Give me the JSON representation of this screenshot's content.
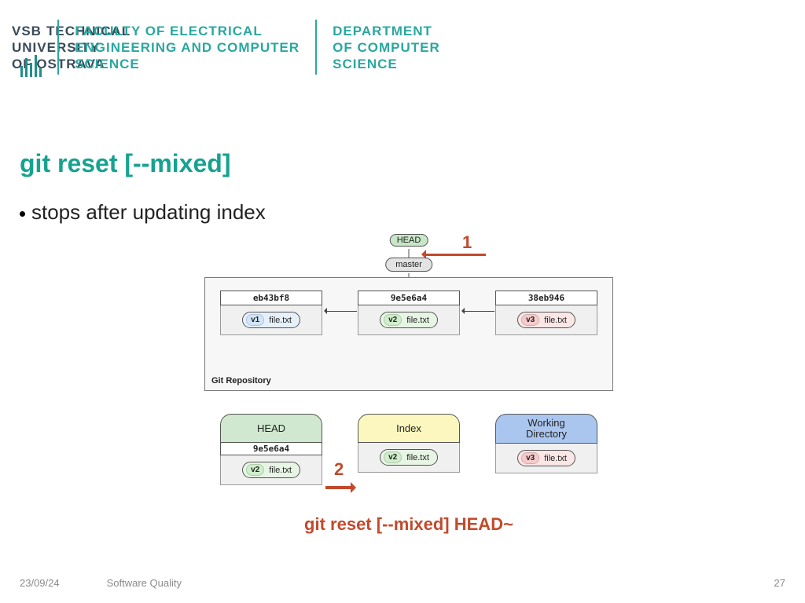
{
  "header": {
    "vsb_abbrev": "VSB",
    "university_line1": "TECHNICAL",
    "university_line2": "UNIVERSITY",
    "university_line3": "OF OSTRAVA",
    "faculty_line1": "FACULTY OF ELECTRICAL",
    "faculty_line2": "ENGINEERING AND COMPUTER",
    "faculty_line3": "SCIENCE",
    "dept_line1": "DEPARTMENT",
    "dept_line2": "OF COMPUTER",
    "dept_line3": "SCIENCE"
  },
  "title": "git reset [--mixed]",
  "bullet": "stops after updating index",
  "diagram": {
    "head_pill": "HEAD",
    "master_pill": "master",
    "repo_label": "Git Repository",
    "commits": [
      {
        "sha": "eb43bf8",
        "version": "v1",
        "file": "file.txt"
      },
      {
        "sha": "9e5e6a4",
        "version": "v2",
        "file": "file.txt"
      },
      {
        "sha": "38eb946",
        "version": "v3",
        "file": "file.txt"
      }
    ],
    "step1": "1",
    "step2": "2",
    "areas": {
      "head": {
        "label": "HEAD",
        "sha": "9e5e6a4",
        "version": "v2",
        "file": "file.txt"
      },
      "index": {
        "label": "Index",
        "version": "v2",
        "file": "file.txt"
      },
      "work": {
        "label_line1": "Working",
        "label_line2": "Directory",
        "version": "v3",
        "file": "file.txt"
      }
    },
    "command_caption": "git reset [--mixed] HEAD~"
  },
  "footer": {
    "date": "23/09/24",
    "course": "Software Quality",
    "page": "27"
  }
}
